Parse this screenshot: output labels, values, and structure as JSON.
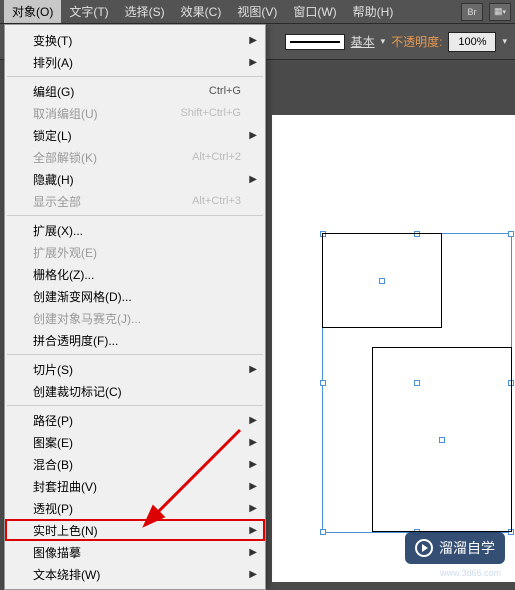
{
  "menubar": {
    "items": [
      "对象(O)",
      "文字(T)",
      "选择(S)",
      "效果(C)",
      "视图(V)",
      "窗口(W)",
      "帮助(H)"
    ],
    "active_index": 0,
    "br_label": "Br"
  },
  "toolbar": {
    "basic_label": "基本",
    "opacity_label": "不透明度:",
    "opacity_value": "100%"
  },
  "menu": {
    "items": [
      {
        "label": "变换(T)",
        "submenu": true
      },
      {
        "label": "排列(A)",
        "submenu": true
      },
      {
        "sep": true
      },
      {
        "label": "编组(G)",
        "shortcut": "Ctrl+G"
      },
      {
        "label": "取消编组(U)",
        "shortcut": "Shift+Ctrl+G",
        "disabled": true
      },
      {
        "label": "锁定(L)",
        "submenu": true
      },
      {
        "label": "全部解锁(K)",
        "shortcut": "Alt+Ctrl+2",
        "disabled": true
      },
      {
        "label": "隐藏(H)",
        "submenu": true
      },
      {
        "label": "显示全部",
        "shortcut": "Alt+Ctrl+3",
        "disabled": true
      },
      {
        "sep": true
      },
      {
        "label": "扩展(X)..."
      },
      {
        "label": "扩展外观(E)",
        "disabled": true
      },
      {
        "label": "栅格化(Z)..."
      },
      {
        "label": "创建渐变网格(D)..."
      },
      {
        "label": "创建对象马赛克(J)...",
        "disabled": true
      },
      {
        "label": "拼合透明度(F)..."
      },
      {
        "sep": true
      },
      {
        "label": "切片(S)",
        "submenu": true
      },
      {
        "label": "创建裁切标记(C)"
      },
      {
        "sep": true
      },
      {
        "label": "路径(P)",
        "submenu": true
      },
      {
        "label": "图案(E)",
        "submenu": true
      },
      {
        "label": "混合(B)",
        "submenu": true
      },
      {
        "label": "封套扭曲(V)",
        "submenu": true
      },
      {
        "label": "透视(P)",
        "submenu": true
      },
      {
        "label": "实时上色(N)",
        "submenu": true,
        "highlighted": true
      },
      {
        "label": "图像描摹",
        "submenu": true
      },
      {
        "label": "文本绕排(W)",
        "submenu": true
      }
    ]
  },
  "watermark": {
    "text": "溜溜自学",
    "url": "www.3d66.com"
  }
}
